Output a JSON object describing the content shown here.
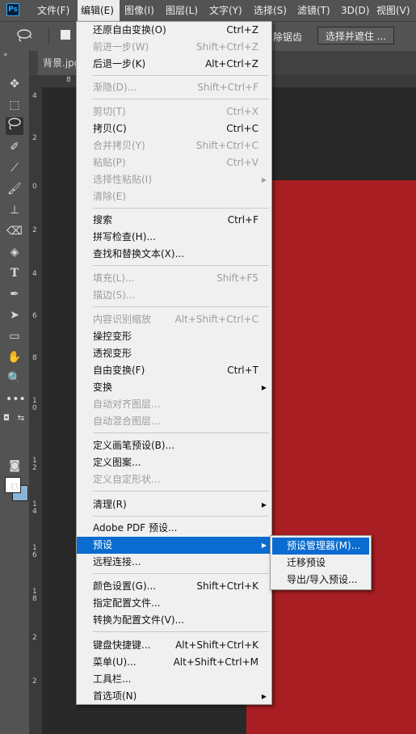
{
  "app": {
    "logo": "Ps"
  },
  "menubar": [
    {
      "label": "文件(F)"
    },
    {
      "label": "编辑(E)"
    },
    {
      "label": "图像(I)"
    },
    {
      "label": "图层(L)"
    },
    {
      "label": "文字(Y)"
    },
    {
      "label": "选择(S)"
    },
    {
      "label": "滤镜(T)"
    },
    {
      "label": "3D(D)"
    },
    {
      "label": "视图(V)"
    }
  ],
  "options_bar": {
    "lasso_icon": "lasso-icon",
    "partial_text": "除锯齿",
    "select_mask_button": "选择并遮住 ..."
  },
  "document_tab": {
    "label": "背景.jpg"
  },
  "ruler": {
    "top_numbers": [
      "8"
    ],
    "left_numbers": [
      "4",
      "2",
      "0",
      "2",
      "4",
      "6",
      "8",
      "1\n0",
      "1\n2",
      "1\n4",
      "1\n6",
      "1\n8",
      "2",
      "2"
    ]
  },
  "edit_menu": {
    "items": [
      {
        "label": "还原自由变换(O)",
        "shortcut": "Ctrl+Z",
        "disabled": false
      },
      {
        "label": "前进一步(W)",
        "shortcut": "Shift+Ctrl+Z",
        "disabled": true
      },
      {
        "label": "后退一步(K)",
        "shortcut": "Alt+Ctrl+Z",
        "disabled": false
      },
      {
        "label": "渐隐(D)...",
        "shortcut": "Shift+Ctrl+F",
        "disabled": true
      },
      {
        "label": "剪切(T)",
        "shortcut": "Ctrl+X",
        "disabled": true
      },
      {
        "label": "拷贝(C)",
        "shortcut": "Ctrl+C",
        "disabled": false
      },
      {
        "label": "合并拷贝(Y)",
        "shortcut": "Shift+Ctrl+C",
        "disabled": true
      },
      {
        "label": "粘贴(P)",
        "shortcut": "Ctrl+V",
        "disabled": true
      },
      {
        "label": "选择性粘贴(I)",
        "shortcut": "",
        "disabled": true
      },
      {
        "label": "清除(E)",
        "shortcut": "",
        "disabled": true
      },
      {
        "label": "搜索",
        "shortcut": "Ctrl+F",
        "disabled": false
      },
      {
        "label": "拼写检查(H)...",
        "shortcut": "",
        "disabled": false
      },
      {
        "label": "查找和替换文本(X)...",
        "shortcut": "",
        "disabled": false
      },
      {
        "label": "填充(L)...",
        "shortcut": "Shift+F5",
        "disabled": true
      },
      {
        "label": "描边(S)...",
        "shortcut": "",
        "disabled": true
      },
      {
        "label": "内容识别缩放",
        "shortcut": "Alt+Shift+Ctrl+C",
        "disabled": true
      },
      {
        "label": "操控变形",
        "shortcut": "",
        "disabled": false
      },
      {
        "label": "透视变形",
        "shortcut": "",
        "disabled": false
      },
      {
        "label": "自由变换(F)",
        "shortcut": "Ctrl+T",
        "disabled": false
      },
      {
        "label": "变换",
        "shortcut": "",
        "disabled": false
      },
      {
        "label": "自动对齐图层...",
        "shortcut": "",
        "disabled": true
      },
      {
        "label": "自动混合图层...",
        "shortcut": "",
        "disabled": true
      },
      {
        "label": "定义画笔预设(B)...",
        "shortcut": "",
        "disabled": false
      },
      {
        "label": "定义图案...",
        "shortcut": "",
        "disabled": false
      },
      {
        "label": "定义自定形状...",
        "shortcut": "",
        "disabled": true
      },
      {
        "label": "清理(R)",
        "shortcut": "",
        "disabled": false
      },
      {
        "label": "Adobe PDF 预设...",
        "shortcut": "",
        "disabled": false
      },
      {
        "label": "预设",
        "shortcut": "",
        "disabled": false
      },
      {
        "label": "远程连接...",
        "shortcut": "",
        "disabled": false
      },
      {
        "label": "颜色设置(G)...",
        "shortcut": "Shift+Ctrl+K",
        "disabled": false
      },
      {
        "label": "指定配置文件...",
        "shortcut": "",
        "disabled": false
      },
      {
        "label": "转换为配置文件(V)...",
        "shortcut": "",
        "disabled": false
      },
      {
        "label": "键盘快捷键...",
        "shortcut": "Alt+Shift+Ctrl+K",
        "disabled": false
      },
      {
        "label": "菜单(U)...",
        "shortcut": "Alt+Shift+Ctrl+M",
        "disabled": false
      },
      {
        "label": "工具栏...",
        "shortcut": "",
        "disabled": false
      },
      {
        "label": "首选项(N)",
        "shortcut": "",
        "disabled": false
      }
    ]
  },
  "presets_submenu": {
    "items": [
      {
        "label": "预设管理器(M)..."
      },
      {
        "label": "迁移预设"
      },
      {
        "label": "导出/导入预设..."
      }
    ]
  },
  "colors": {
    "highlight": "#0a6cd0",
    "canvas_red": "#a81e22",
    "menu_bg": "#f0f0f0"
  },
  "tools": [
    "move-icon",
    "marquee-icon",
    "lasso-icon",
    "quick-select-icon",
    "eyedropper-icon",
    "brush-icon",
    "stamp-icon",
    "eraser-icon",
    "paint-bucket-icon",
    "type-icon",
    "pen-icon",
    "path-select-icon",
    "rectangle-icon",
    "hand-icon",
    "zoom-icon",
    "more-icon"
  ]
}
